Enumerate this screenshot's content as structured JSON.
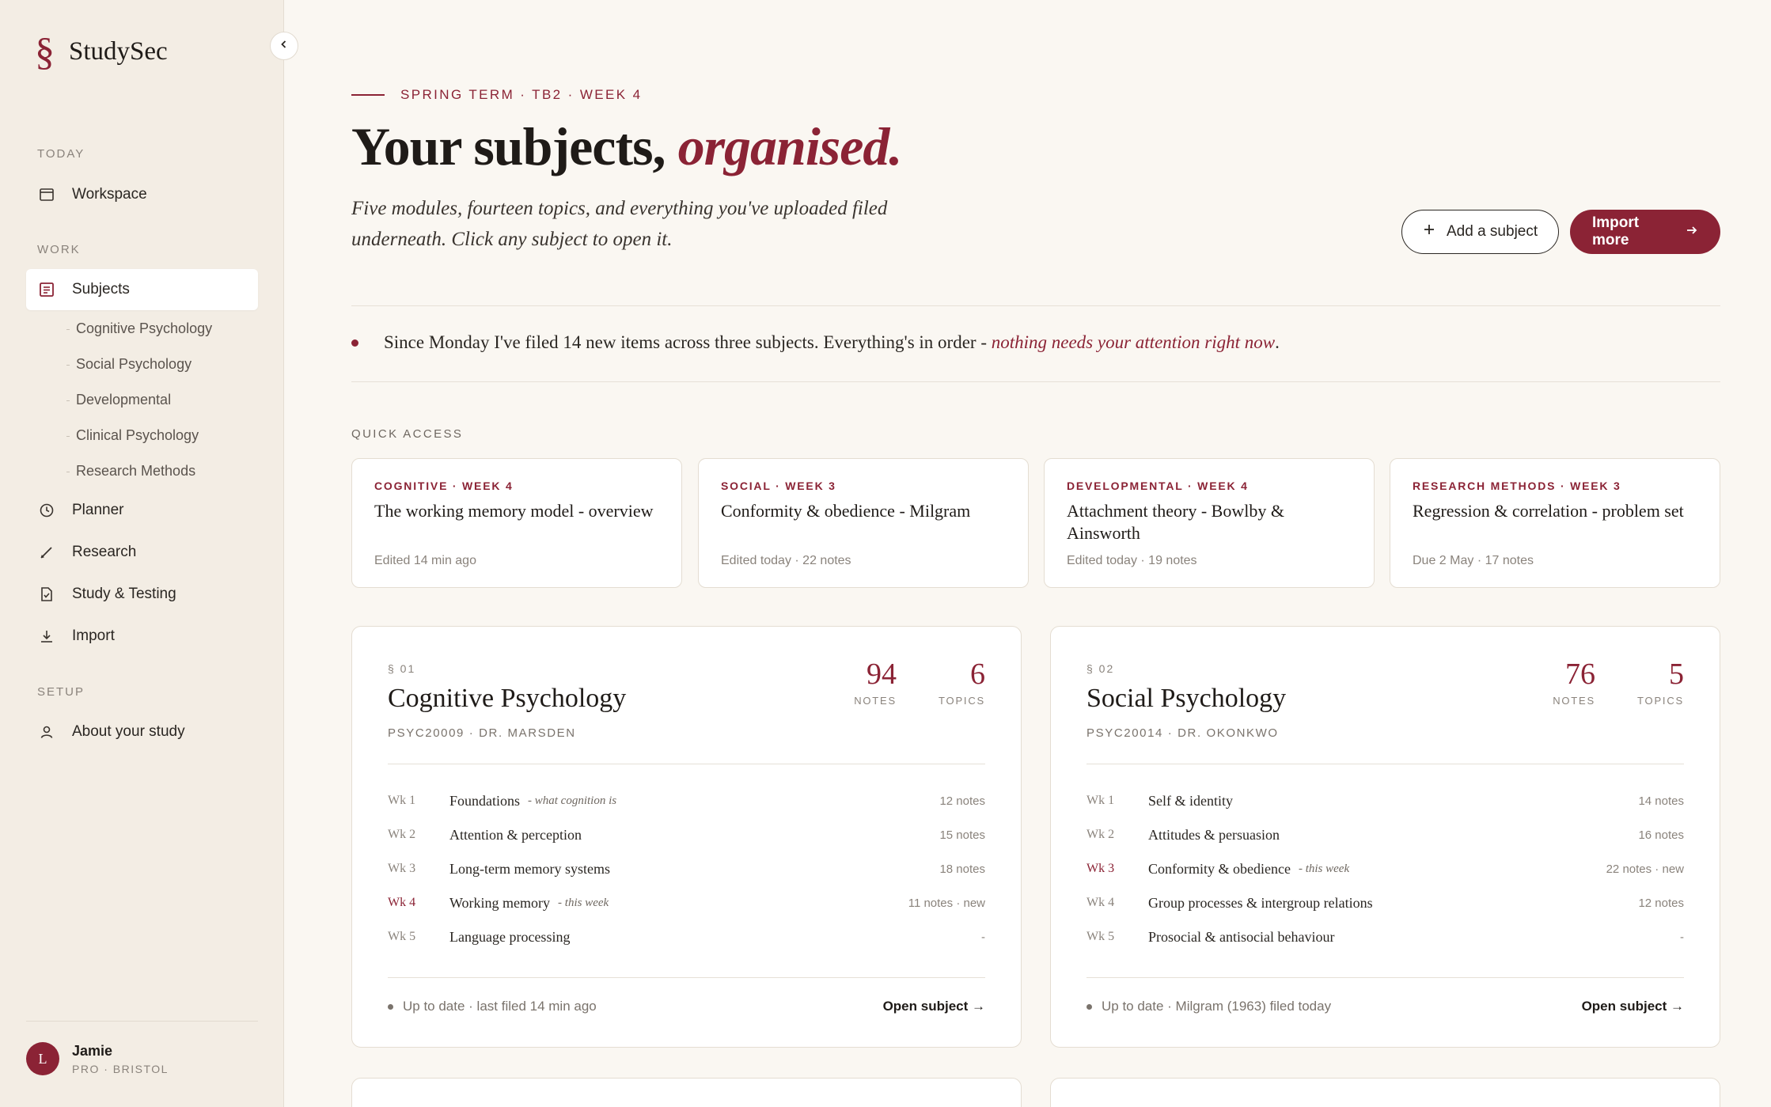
{
  "brand": {
    "mark": "§",
    "name": "StudySec"
  },
  "sidebar": {
    "sections": {
      "today": "TODAY",
      "work": "WORK",
      "setup": "SETUP"
    },
    "items": {
      "workspace": "Workspace",
      "subjects": "Subjects",
      "planner": "Planner",
      "research": "Research",
      "study": "Study & Testing",
      "import": "Import",
      "about": "About your study"
    },
    "subjects": [
      "Cognitive Psychology",
      "Social Psychology",
      "Developmental",
      "Clinical Psychology",
      "Research Methods"
    ]
  },
  "user": {
    "initial": "L",
    "name": "Jamie",
    "meta": "PRO · BRISTOL"
  },
  "header": {
    "eyebrow": "SPRING TERM · TB2 · WEEK 4",
    "title_plain": "Your subjects, ",
    "title_accent": "organised.",
    "intro": "Five modules, fourteen topics, and everything you've uploaded filed underneath. Click any subject to open it.",
    "add_button": "Add a subject",
    "import_button": "Import more"
  },
  "notice": {
    "text": "Since Monday I've filed 14 new items across three subjects. Everything's in order - ",
    "accent": "nothing needs your attention right now",
    "end": "."
  },
  "quick_access": {
    "label": "QUICK ACCESS",
    "cards": [
      {
        "tag": "COGNITIVE · WEEK 4",
        "title": "The working memory model - overview",
        "meta": "Edited 14 min ago"
      },
      {
        "tag": "SOCIAL · WEEK 3",
        "title": "Conformity & obedience - Milgram",
        "meta": "Edited today · 22 notes"
      },
      {
        "tag": "DEVELOPMENTAL · WEEK 4",
        "title": "Attachment theory - Bowlby & Ainsworth",
        "meta": "Edited today · 19 notes"
      },
      {
        "tag": "RESEARCH METHODS · WEEK 3",
        "title": "Regression & correlation - problem set",
        "meta": "Due 2 May · 17 notes"
      }
    ]
  },
  "subjects": [
    {
      "num": "§ 01",
      "title": "Cognitive Psychology",
      "code": "PSYC20009 · DR. MARSDEN",
      "notes": "94",
      "notes_label": "NOTES",
      "topics": "6",
      "topics_label": "TOPICS",
      "rows": [
        {
          "wk": "Wk 1",
          "topic": "Foundations",
          "hint": "- what cognition is",
          "count": "12 notes"
        },
        {
          "wk": "Wk 2",
          "topic": "Attention & perception",
          "hint": "",
          "count": "15 notes"
        },
        {
          "wk": "Wk 3",
          "topic": "Long-term memory systems",
          "hint": "",
          "count": "18 notes"
        },
        {
          "wk": "Wk 4",
          "topic": "Working memory",
          "hint": "- this week",
          "count": "11 notes · new"
        },
        {
          "wk": "Wk 5",
          "topic": "Language processing",
          "hint": "",
          "count": "-"
        }
      ],
      "footer": "Up to date · last filed 14 min ago",
      "link": "Open subject →"
    },
    {
      "num": "§ 02",
      "title": "Social Psychology",
      "code": "PSYC20014 · DR. OKONKWO",
      "notes": "76",
      "notes_label": "NOTES",
      "topics": "5",
      "topics_label": "TOPICS",
      "rows": [
        {
          "wk": "Wk 1",
          "topic": "Self & identity",
          "hint": "",
          "count": "14 notes"
        },
        {
          "wk": "Wk 2",
          "topic": "Attitudes & persuasion",
          "hint": "",
          "count": "16 notes"
        },
        {
          "wk": "Wk 3",
          "topic": "Conformity & obedience",
          "hint": "- this week",
          "count": "22 notes · new"
        },
        {
          "wk": "Wk 4",
          "topic": "Group processes & intergroup relations",
          "hint": "",
          "count": "12 notes"
        },
        {
          "wk": "Wk 5",
          "topic": "Prosocial & antisocial behaviour",
          "hint": "",
          "count": "-"
        }
      ],
      "footer": "Up to date · Milgram (1963) filed today",
      "link": "Open subject →"
    }
  ],
  "colors": {
    "accent": "#8b2335",
    "sidebar": "#f3ede4",
    "background": "#faf7f2"
  }
}
